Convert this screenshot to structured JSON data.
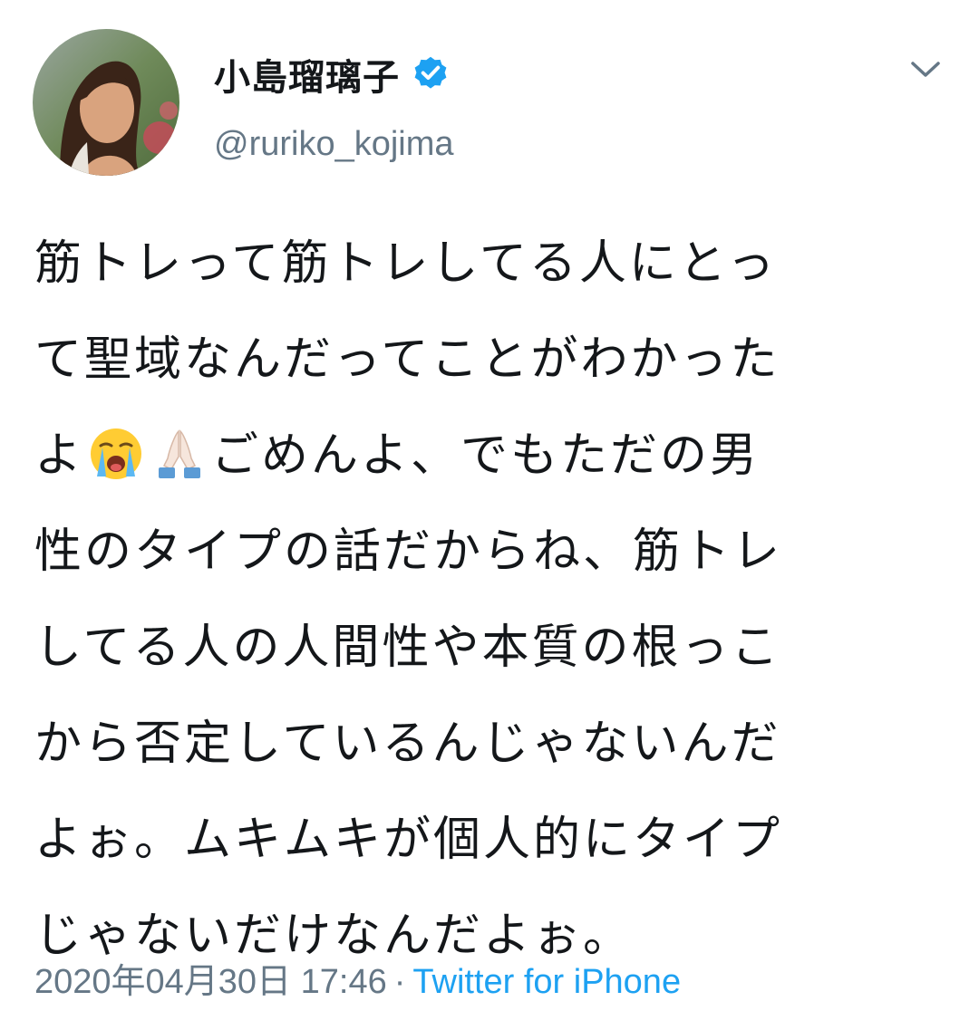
{
  "user": {
    "display_name": "小島瑠璃子",
    "handle": "@ruriko_kojima",
    "verified_icon": "verified-badge-icon"
  },
  "tweet": {
    "lines": [
      "筋トレって筋トレしてる人にとっ",
      "て聖域なんだってことがわかった",
      "よ",
      "ごめんよ、でもただの男",
      "性のタイプの話だからね、筋トレ",
      "してる人の人間性や本質の根っこ",
      "から否定しているんじゃないんだ",
      "よぉ。ムキムキが個人的にタイプ",
      "じゃないだけなんだよぉ。"
    ],
    "emojis": [
      "loudly-crying-face-icon",
      "folded-hands-icon"
    ],
    "timestamp": "2020年04月30日 17:46",
    "separator": "·",
    "source": "Twitter for iPhone"
  },
  "colors": {
    "text": "#14171a",
    "secondary": "#657786",
    "accent": "#1da1f2"
  }
}
